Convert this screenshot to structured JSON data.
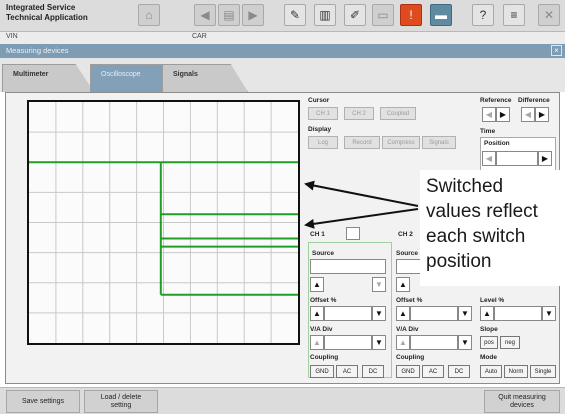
{
  "app": {
    "title_line1": "Integrated Service",
    "title_line2": "Technical Application"
  },
  "toolbar_icons": [
    "home-icon",
    "arrow-left-icon",
    "document-icon",
    "arrow-right-icon",
    "wrench-icon",
    "book-icon",
    "tools-icon",
    "window-icon",
    "battery-warning-icon",
    "screen-icon",
    "help-icon",
    "print-icon",
    "close-icon"
  ],
  "info": {
    "vin_label": "VIN",
    "car_label": "CAR"
  },
  "window": {
    "title": "Measuring devices",
    "close": "×"
  },
  "tabs": [
    {
      "label": "Multimeter",
      "selected": false
    },
    {
      "label": "Oscilloscope",
      "selected": true
    },
    {
      "label": "Signals",
      "selected": false
    }
  ],
  "scope": {
    "grid_columns": 10,
    "grid_rows": 8,
    "trace_color": "#1f9e2a",
    "trace_levels": [
      0.25,
      0.466,
      0.6,
      0.8
    ]
  },
  "controls": {
    "cursor": {
      "label": "Cursor",
      "ch1": "CH 1",
      "ch2": "CH 2",
      "coupled": "Coupled"
    },
    "display": {
      "label": "Display",
      "log": "Log",
      "record": "Record",
      "compress": "Compress",
      "signals": "Signals"
    },
    "reference": "Reference",
    "difference": "Difference",
    "time": {
      "label": "Time",
      "position": "Position"
    },
    "ch1_label": "CH 1",
    "ch2_label": "CH 2",
    "source": "Source",
    "offset": "Offset %",
    "level": "Level %",
    "va_div": "V/A Div",
    "slope": {
      "label": "Slope",
      "pos": "pos",
      "neg": "neg"
    },
    "coupling": {
      "label": "Coupling",
      "gnd": "GND",
      "ac": "AC",
      "dc": "DC"
    },
    "mode": {
      "label": "Mode",
      "auto": "Auto",
      "norm": "Norm",
      "single": "Single"
    }
  },
  "annotation": {
    "lines": [
      "Switched",
      "values reflect",
      "each switch",
      "position"
    ]
  },
  "bottom": {
    "save": "Save settings",
    "load_line1": "Load / delete",
    "load_line2": "setting",
    "quit_line1": "Quit measuring",
    "quit_line2": "devices"
  }
}
